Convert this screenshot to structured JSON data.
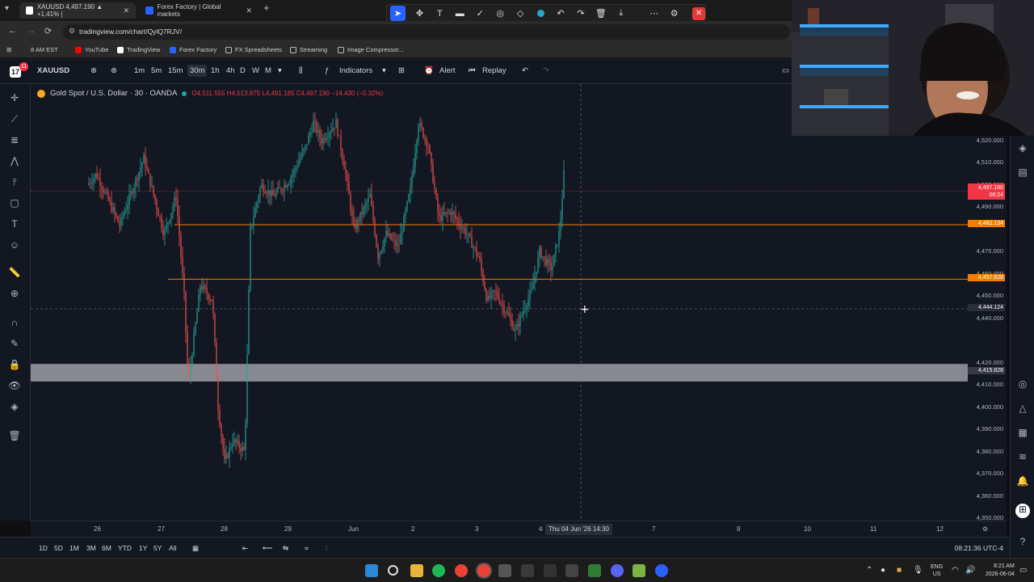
{
  "browser": {
    "tabs": [
      {
        "title": "XAUUSD 4,497.190 ▲ +1.41% |",
        "active": true
      },
      {
        "title": "Forex Factory | Global markets",
        "active": false
      }
    ],
    "url": "tradingview.com/chart/QylQ7RJV/",
    "bookmarks": [
      "8 AM EST",
      "YouTube",
      "TradingView",
      "Forex Factory",
      "FX Spreadsheets",
      "Streaming",
      "Image Compressor..."
    ]
  },
  "toolbar": {
    "badge": "11",
    "symbol": "XAUUSD",
    "intervals": [
      "1m",
      "5m",
      "15m",
      "30m",
      "1h",
      "4h",
      "D",
      "W",
      "M"
    ],
    "selected_interval": "30m",
    "indicators_label": "Indicators",
    "alert_label": "Alert",
    "replay_label": "Replay"
  },
  "legend": {
    "name": "Gold Spot / U.S. Dollar · 30 · OANDA",
    "ohlc": "O4,511.555 H4,513.875 L4,491.185 C4,497.190 −14.430 (−0.32%)"
  },
  "price_axis": {
    "labels": [
      "4,520.000",
      "4,510.000",
      "4,500.000",
      "4,490.000",
      "4,470.000",
      "4,460.000",
      "4,450.000",
      "4,440.000",
      "4,420.000",
      "4,410.000",
      "4,400.000",
      "4,390.000",
      "4,380.000",
      "4,370.000",
      "4,360.000",
      "4,350.000"
    ],
    "current_price": "4,497.190",
    "countdown": "08:24",
    "level_upper": "4,482.134",
    "level_lower": "4,457.628",
    "crosshair_price": "4,444.124",
    "zone_price": "4,415.828",
    "current_color": "#f23645",
    "level_color": "#f57c00"
  },
  "time_axis": {
    "labels": [
      "26",
      "27",
      "28",
      "29",
      "Jun",
      "2",
      "3",
      "4",
      "7",
      "9",
      "10",
      "11",
      "12"
    ],
    "crosshair_time": "Thu 04 Jun '26   14:30"
  },
  "bottom": {
    "ranges": [
      "1D",
      "5D",
      "1M",
      "3M",
      "6M",
      "YTD",
      "1Y",
      "5Y",
      "All"
    ],
    "clock": "08:21:36 UTC-4"
  },
  "taskbar": {
    "lang": [
      "ENG",
      "US"
    ],
    "time": "8:21 AM",
    "date": "2026-06-04"
  },
  "chart_data": {
    "type": "candlestick",
    "symbol": "XAUUSD",
    "timeframe": "30",
    "x": [
      "26",
      "27",
      "28",
      "29",
      "Jun",
      "2",
      "3",
      "4"
    ],
    "close": [
      4495,
      4462,
      4372,
      4500,
      4520,
      4470,
      4450,
      4497
    ],
    "ylim": [
      4350,
      4525
    ],
    "levels": [
      4482.134,
      4457.628
    ],
    "zone": [
      4413,
      4418
    ]
  }
}
